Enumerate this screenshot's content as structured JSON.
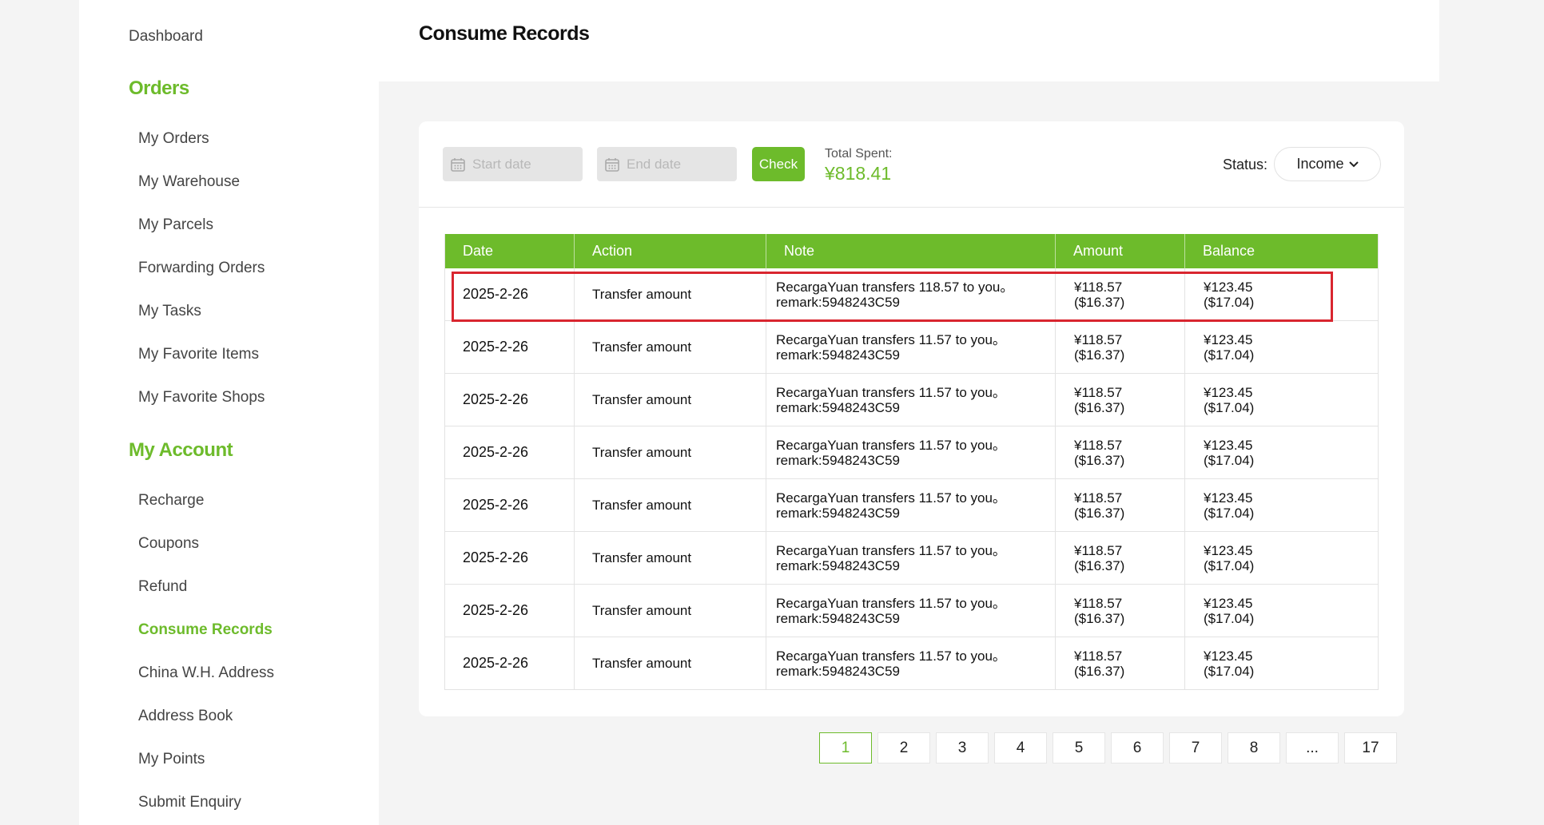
{
  "sidebar": {
    "dashboard": "Dashboard",
    "orders_heading": "Orders",
    "orders_items": [
      "My Orders",
      "My Warehouse",
      "My Parcels",
      "Forwarding Orders",
      "My Tasks",
      "My Favorite Items",
      "My Favorite Shops"
    ],
    "account_heading": "My Account",
    "account_items": [
      "Recharge",
      "Coupons",
      "Refund",
      "Consume Records",
      "China W.H. Address",
      "Address Book",
      "My Points",
      "Submit Enquiry"
    ],
    "active_item": "Consume Records"
  },
  "header": {
    "title": "Consume Records"
  },
  "filters": {
    "start_placeholder": "Start date",
    "end_placeholder": "End date",
    "check_label": "Check",
    "total_label": "Total Spent:",
    "total_value": "¥818.41",
    "status_label": "Status:",
    "status_value": "Income"
  },
  "table": {
    "columns": [
      "Date",
      "Action",
      "Note",
      "Amount",
      "Balance"
    ],
    "rows": [
      {
        "date": "2025-2-26",
        "action": "Transfer amount",
        "note1": "RecargaYuan transfers 118.57 to you。",
        "note2": "remark:5948243C59",
        "amount1": "¥118.57",
        "amount2": "($16.37)",
        "balance1": "¥123.45",
        "balance2": "($17.04)"
      },
      {
        "date": "2025-2-26",
        "action": "Transfer amount",
        "note1": "RecargaYuan transfers 11.57 to you。",
        "note2": "remark:5948243C59",
        "amount1": "¥118.57",
        "amount2": "($16.37)",
        "balance1": "¥123.45",
        "balance2": "($17.04)"
      },
      {
        "date": "2025-2-26",
        "action": "Transfer amount",
        "note1": "RecargaYuan transfers 11.57 to you。",
        "note2": "remark:5948243C59",
        "amount1": "¥118.57",
        "amount2": "($16.37)",
        "balance1": "¥123.45",
        "balance2": "($17.04)"
      },
      {
        "date": "2025-2-26",
        "action": "Transfer amount",
        "note1": "RecargaYuan transfers 11.57 to you。",
        "note2": "remark:5948243C59",
        "amount1": "¥118.57",
        "amount2": "($16.37)",
        "balance1": "¥123.45",
        "balance2": "($17.04)"
      },
      {
        "date": "2025-2-26",
        "action": "Transfer amount",
        "note1": "RecargaYuan transfers 11.57 to you。",
        "note2": "remark:5948243C59",
        "amount1": "¥118.57",
        "amount2": "($16.37)",
        "balance1": "¥123.45",
        "balance2": "($17.04)"
      },
      {
        "date": "2025-2-26",
        "action": "Transfer amount",
        "note1": "RecargaYuan transfers 11.57 to you。",
        "note2": "remark:5948243C59",
        "amount1": "¥118.57",
        "amount2": "($16.37)",
        "balance1": "¥123.45",
        "balance2": "($17.04)"
      },
      {
        "date": "2025-2-26",
        "action": "Transfer amount",
        "note1": "RecargaYuan transfers 11.57 to you。",
        "note2": "remark:5948243C59",
        "amount1": "¥118.57",
        "amount2": "($16.37)",
        "balance1": "¥123.45",
        "balance2": "($17.04)"
      },
      {
        "date": "2025-2-26",
        "action": "Transfer amount",
        "note1": "RecargaYuan transfers 11.57 to you。",
        "note2": "remark:5948243C59",
        "amount1": "¥118.57",
        "amount2": "($16.37)",
        "balance1": "¥123.45",
        "balance2": "($17.04)"
      }
    ]
  },
  "pagination": {
    "pages": [
      "1",
      "2",
      "3",
      "4",
      "5",
      "6",
      "7",
      "8",
      "...",
      "17"
    ],
    "current": "1"
  },
  "colors": {
    "accent": "#6dbb2b",
    "highlight": "#d9262f"
  },
  "icons": {
    "date_icon": "calendar-icon",
    "status_icon": "chevron-down-icon"
  }
}
